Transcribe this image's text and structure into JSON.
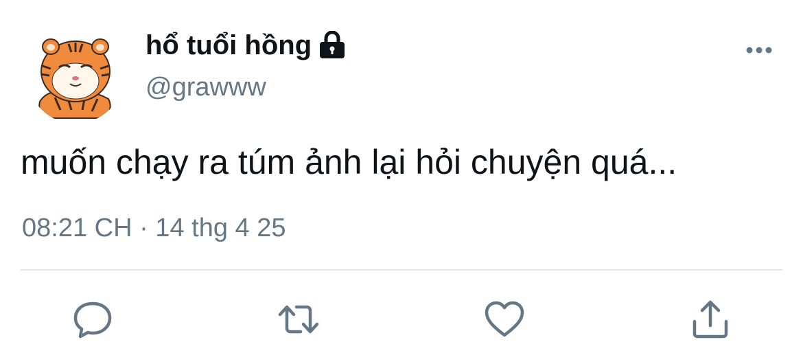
{
  "user": {
    "display_name": "hổ tuổi hồng",
    "handle": "@grawww",
    "avatar_icon": "tiger-avatar",
    "protected_icon": "lock-icon"
  },
  "tweet": {
    "text": "muốn chạy ra túm ảnh lại hỏi chuyện quá...",
    "timestamp": "08:21 CH · 14 thg 4 25"
  },
  "actions": {
    "reply_icon": "reply-icon",
    "retweet_icon": "retweet-icon",
    "like_icon": "heart-icon",
    "share_icon": "share-icon",
    "more_icon": "more-icon"
  },
  "colors": {
    "text": "#0f1419",
    "secondary_text": "#657786",
    "icon": "#657786",
    "divider": "#e1e8ed",
    "tiger_orange": "#f08a3c"
  }
}
